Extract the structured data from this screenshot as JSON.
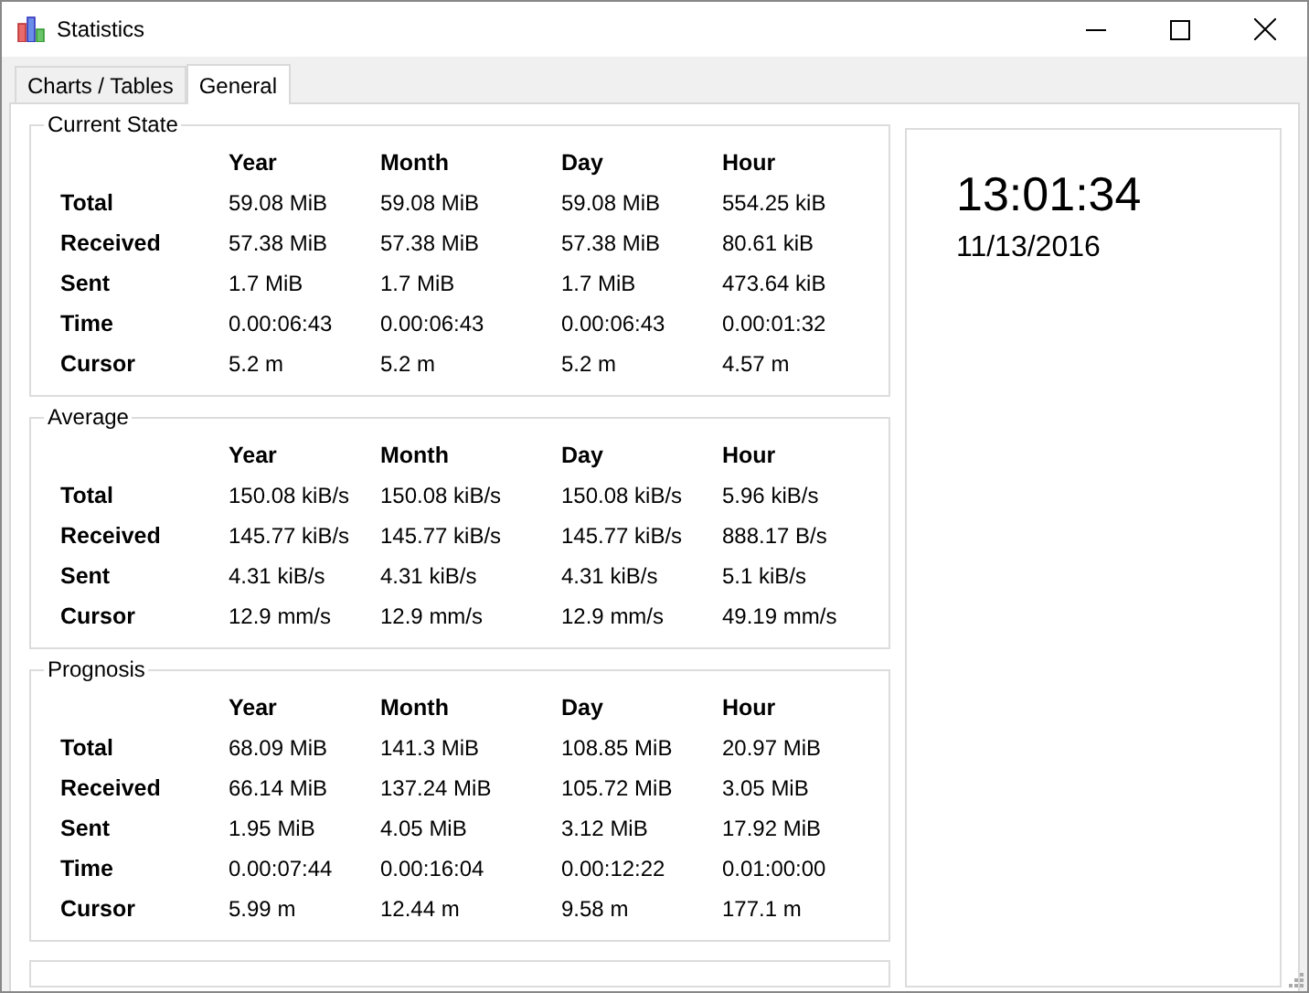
{
  "window": {
    "title": "Statistics"
  },
  "tabs": [
    {
      "label": "Charts / Tables",
      "selected": false
    },
    {
      "label": "General",
      "selected": true
    }
  ],
  "sections": [
    {
      "title": "Current State",
      "columns": [
        "Year",
        "Month",
        "Day",
        "Hour"
      ],
      "rows": [
        {
          "label": "Total",
          "values": [
            "59.08 MiB",
            "59.08 MiB",
            "59.08 MiB",
            "554.25 kiB"
          ]
        },
        {
          "label": "Received",
          "values": [
            "57.38 MiB",
            "57.38 MiB",
            "57.38 MiB",
            "80.61 kiB"
          ]
        },
        {
          "label": "Sent",
          "values": [
            "1.7 MiB",
            "1.7 MiB",
            "1.7 MiB",
            "473.64 kiB"
          ]
        },
        {
          "label": "Time",
          "values": [
            "0.00:06:43",
            "0.00:06:43",
            "0.00:06:43",
            "0.00:01:32"
          ]
        },
        {
          "label": "Cursor",
          "values": [
            "5.2 m",
            "5.2 m",
            "5.2 m",
            "4.57 m"
          ]
        }
      ]
    },
    {
      "title": "Average",
      "columns": [
        "Year",
        "Month",
        "Day",
        "Hour"
      ],
      "rows": [
        {
          "label": "Total",
          "values": [
            "150.08 kiB/s",
            "150.08 kiB/s",
            "150.08 kiB/s",
            "5.96 kiB/s"
          ]
        },
        {
          "label": "Received",
          "values": [
            "145.77 kiB/s",
            "145.77 kiB/s",
            "145.77 kiB/s",
            "888.17 B/s"
          ]
        },
        {
          "label": "Sent",
          "values": [
            "4.31 kiB/s",
            "4.31 kiB/s",
            "4.31 kiB/s",
            "5.1 kiB/s"
          ]
        },
        {
          "label": "Cursor",
          "values": [
            "12.9 mm/s",
            "12.9 mm/s",
            "12.9 mm/s",
            "49.19 mm/s"
          ]
        }
      ]
    },
    {
      "title": "Prognosis",
      "columns": [
        "Year",
        "Month",
        "Day",
        "Hour"
      ],
      "rows": [
        {
          "label": "Total",
          "values": [
            "68.09 MiB",
            "141.3 MiB",
            "108.85 MiB",
            "20.97 MiB"
          ]
        },
        {
          "label": "Received",
          "values": [
            "66.14 MiB",
            "137.24 MiB",
            "105.72 MiB",
            "3.05 MiB"
          ]
        },
        {
          "label": "Sent",
          "values": [
            "1.95 MiB",
            "4.05 MiB",
            "3.12 MiB",
            "17.92 MiB"
          ]
        },
        {
          "label": "Time",
          "values": [
            "0.00:07:44",
            "0.00:16:04",
            "0.00:12:22",
            "0.01:00:00"
          ]
        },
        {
          "label": "Cursor",
          "values": [
            "5.99 m",
            "12.44 m",
            "9.58 m",
            "177.1 m"
          ]
        }
      ]
    }
  ],
  "clock": {
    "time": "13:01:34",
    "date": "11/13/2016"
  }
}
